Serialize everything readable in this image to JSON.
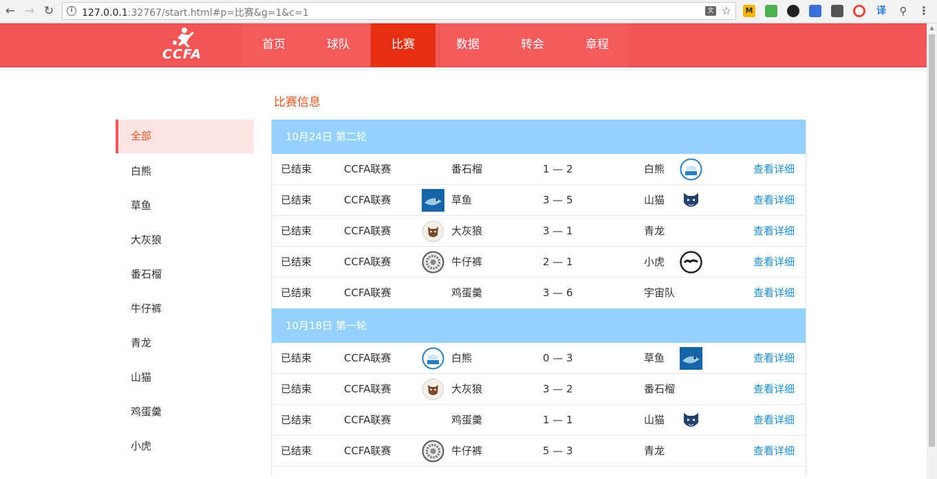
{
  "browser": {
    "url_host": "127.0.0.1",
    "url_rest": ":32767/start.html#p=比赛&g=1&c=1"
  },
  "site": {
    "logo_text": "CCFA",
    "nav": [
      {
        "label": "首页",
        "active": false
      },
      {
        "label": "球队",
        "active": false
      },
      {
        "label": "比赛",
        "active": true
      },
      {
        "label": "数据",
        "active": false
      },
      {
        "label": "转会",
        "active": false
      },
      {
        "label": "章程",
        "active": false
      }
    ]
  },
  "sidebar": {
    "items": [
      {
        "label": "全部",
        "active": true
      },
      {
        "label": "白熊",
        "active": false
      },
      {
        "label": "草鱼",
        "active": false
      },
      {
        "label": "大灰狼",
        "active": false
      },
      {
        "label": "番石榴",
        "active": false
      },
      {
        "label": "牛仔裤",
        "active": false
      },
      {
        "label": "青龙",
        "active": false
      },
      {
        "label": "山猫",
        "active": false
      },
      {
        "label": "鸡蛋羹",
        "active": false
      },
      {
        "label": "小虎",
        "active": false
      }
    ]
  },
  "content": {
    "title": "比赛信息",
    "rounds": [
      {
        "header": "10月24日 第二轮",
        "matches": [
          {
            "status": "已结束",
            "league": "CCFA联赛",
            "home": "番石榴",
            "home_badge": "",
            "score": "1 — 2",
            "away": "白熊",
            "away_badge": "bear",
            "detail": "查看详细"
          },
          {
            "status": "已结束",
            "league": "CCFA联赛",
            "home": "草鱼",
            "home_badge": "shark",
            "score": "3 — 5",
            "away": "山猫",
            "away_badge": "lynx",
            "detail": "查看详细"
          },
          {
            "status": "已结束",
            "league": "CCFA联赛",
            "home": "大灰狼",
            "home_badge": "wolf",
            "score": "3 — 1",
            "away": "青龙",
            "away_badge": "",
            "detail": "查看详细"
          },
          {
            "status": "已结束",
            "league": "CCFA联赛",
            "home": "牛仔裤",
            "home_badge": "jeans",
            "score": "2 — 1",
            "away": "小虎",
            "away_badge": "tiger",
            "detail": "查看详细"
          },
          {
            "status": "已结束",
            "league": "CCFA联赛",
            "home": "鸡蛋羹",
            "home_badge": "",
            "score": "3 — 6",
            "away": "宇宙队",
            "away_badge": "",
            "detail": "查看详细"
          }
        ]
      },
      {
        "header": "10月18日 第一轮",
        "matches": [
          {
            "status": "已结束",
            "league": "CCFA联赛",
            "home": "白熊",
            "home_badge": "bear",
            "score": "0 — 3",
            "away": "草鱼",
            "away_badge": "shark",
            "detail": "查看详细"
          },
          {
            "status": "已结束",
            "league": "CCFA联赛",
            "home": "大灰狼",
            "home_badge": "wolf",
            "score": "3 — 2",
            "away": "番石榴",
            "away_badge": "",
            "detail": "查看详细"
          },
          {
            "status": "已结束",
            "league": "CCFA联赛",
            "home": "鸡蛋羹",
            "home_badge": "",
            "score": "1 — 1",
            "away": "山猫",
            "away_badge": "lynx",
            "detail": "查看详细"
          },
          {
            "status": "已结束",
            "league": "CCFA联赛",
            "home": "牛仔裤",
            "home_badge": "jeans",
            "score": "5 — 3",
            "away": "青龙",
            "away_badge": "",
            "detail": "查看详细"
          }
        ]
      }
    ]
  },
  "colors": {
    "header_red": "#f15556",
    "nav_active": "#e62e12",
    "accent_orange": "#e8541c",
    "round_blue": "#94d2fd",
    "link_blue": "#1a8dd8"
  }
}
